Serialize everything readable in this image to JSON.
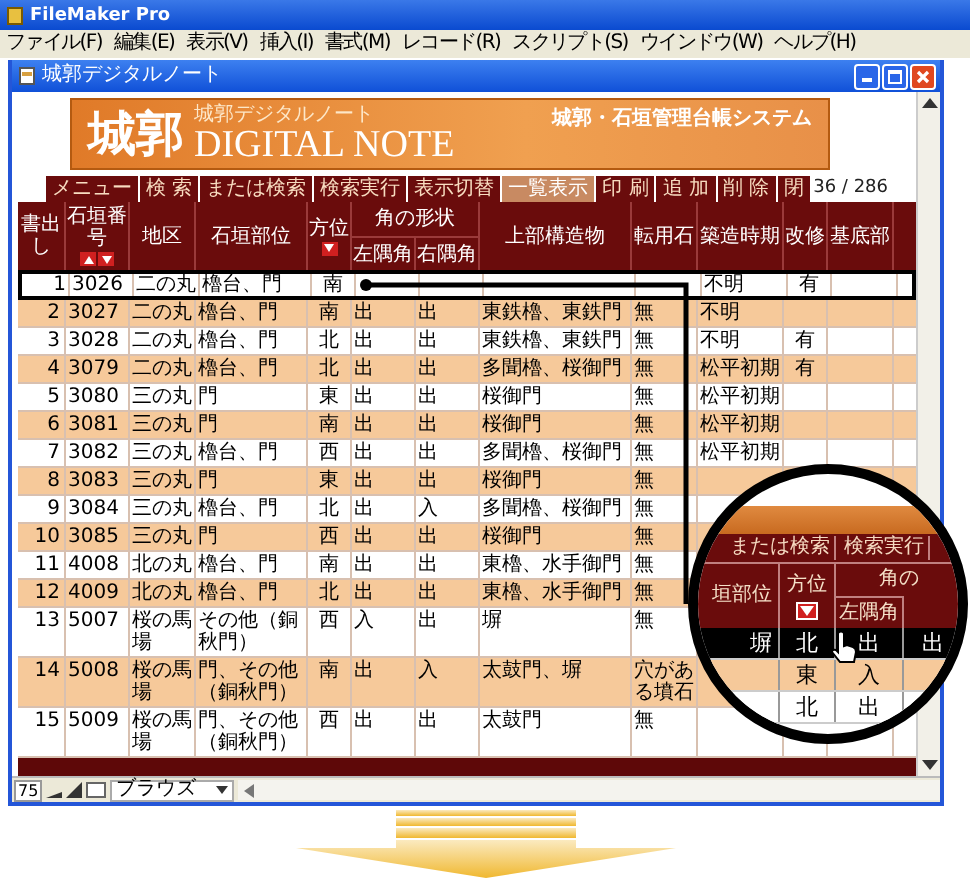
{
  "app_window": {
    "title": "FileMaker Pro"
  },
  "menu": [
    "ファイル(F)",
    "編集(E)",
    "表示(V)",
    "挿入(I)",
    "書式(M)",
    "レコード(R)",
    "スクリプト(S)",
    "ウインドウ(W)",
    "ヘルプ(H)"
  ],
  "document_window": {
    "title": "城郭デジタルノート"
  },
  "banner": {
    "logo": "城郭",
    "subtitle": "城郭デジタルノート",
    "title": "DIGITAL NOTE",
    "system_name": "城郭・石垣管理台帳システム"
  },
  "tabs": [
    {
      "label": "メニュー",
      "selected": false
    },
    {
      "label": "検 索",
      "selected": false
    },
    {
      "label": "または検索",
      "selected": false
    },
    {
      "label": "検索実行",
      "selected": false
    },
    {
      "label": "表示切替",
      "selected": false
    },
    {
      "label": "一覧表示",
      "selected": true
    },
    {
      "label": "印 刷",
      "selected": false
    },
    {
      "label": "追 加",
      "selected": false
    },
    {
      "label": "削 除",
      "selected": false
    },
    {
      "label": "閉",
      "selected": false
    }
  ],
  "record_count": "36 / 286",
  "table": {
    "column_group": "角の形状",
    "columns": [
      {
        "label": "書出し"
      },
      {
        "label": "石垣番号",
        "kind": "sort"
      },
      {
        "label": "地区"
      },
      {
        "label": "石垣部位"
      },
      {
        "label": "方位",
        "kind": "filter"
      },
      {
        "label": "左隅角",
        "grouped": true
      },
      {
        "label": "右隅角",
        "grouped": true
      },
      {
        "label": "上部構造物"
      },
      {
        "label": "転用石"
      },
      {
        "label": "築造時期"
      },
      {
        "label": "改修"
      },
      {
        "label": "基底部"
      }
    ],
    "rows": [
      {
        "selected": true,
        "no": "1",
        "stone_no": "3026",
        "area": "二の丸",
        "part": "櫓台、門",
        "direction": "南",
        "period": "不明",
        "repair": "有"
      },
      {
        "selected": false,
        "no": "2",
        "stone_no": "3027",
        "area": "二の丸",
        "part": "櫓台、門",
        "direction": "南",
        "left_corner": "出",
        "right_corner": "出",
        "upper_structure": "東鉄櫓、東鉄門",
        "reused_stone": "無",
        "period": "不明"
      },
      {
        "selected": false,
        "no": "3",
        "stone_no": "3028",
        "area": "二の丸",
        "part": "櫓台、門",
        "direction": "北",
        "left_corner": "出",
        "right_corner": "出",
        "upper_structure": "東鉄櫓、東鉄門",
        "reused_stone": "無",
        "period": "不明",
        "repair": "有"
      },
      {
        "selected": false,
        "no": "4",
        "stone_no": "3079",
        "area": "二の丸",
        "part": "櫓台、門",
        "direction": "北",
        "left_corner": "出",
        "right_corner": "出",
        "upper_structure": "多聞櫓、桜御門",
        "reused_stone": "無",
        "period": "松平初期",
        "repair": "有"
      },
      {
        "selected": false,
        "no": "5",
        "stone_no": "3080",
        "area": "三の丸",
        "part": "門",
        "direction": "東",
        "left_corner": "出",
        "right_corner": "出",
        "upper_structure": "桜御門",
        "reused_stone": "無",
        "period": "松平初期"
      },
      {
        "selected": false,
        "no": "6",
        "stone_no": "3081",
        "area": "三の丸",
        "part": "門",
        "direction": "南",
        "left_corner": "出",
        "right_corner": "出",
        "upper_structure": "桜御門",
        "reused_stone": "無",
        "period": "松平初期"
      },
      {
        "selected": false,
        "no": "7",
        "stone_no": "3082",
        "area": "三の丸",
        "part": "櫓台、門",
        "direction": "西",
        "left_corner": "出",
        "right_corner": "出",
        "upper_structure": "多聞櫓、桜御門",
        "reused_stone": "無",
        "period": "松平初期"
      },
      {
        "selected": false,
        "no": "8",
        "stone_no": "3083",
        "area": "三の丸",
        "part": "門",
        "direction": "東",
        "left_corner": "出",
        "right_corner": "出",
        "upper_structure": "桜御門",
        "reused_stone": "無"
      },
      {
        "selected": false,
        "no": "9",
        "stone_no": "3084",
        "area": "三の丸",
        "part": "櫓台、門",
        "direction": "北",
        "left_corner": "出",
        "right_corner": "入",
        "upper_structure": "多聞櫓、桜御門",
        "reused_stone": "無"
      },
      {
        "selected": false,
        "no": "10",
        "stone_no": "3085",
        "area": "三の丸",
        "part": "門",
        "direction": "西",
        "left_corner": "出",
        "right_corner": "出",
        "upper_structure": "桜御門",
        "reused_stone": "無"
      },
      {
        "selected": false,
        "no": "11",
        "stone_no": "4008",
        "area": "北の丸",
        "part": "櫓台、門",
        "direction": "南",
        "left_corner": "出",
        "right_corner": "出",
        "upper_structure": "東櫓、水手御門",
        "reused_stone": "無"
      },
      {
        "selected": false,
        "no": "12",
        "stone_no": "4009",
        "area": "北の丸",
        "part": "櫓台、門",
        "direction": "北",
        "left_corner": "出",
        "right_corner": "出",
        "upper_structure": "東櫓、水手御門",
        "reused_stone": "無"
      },
      {
        "selected": false,
        "no": "13",
        "stone_no": "5007",
        "area": "桜の馬場",
        "part": "その他（銅秋門）",
        "direction": "西",
        "left_corner": "入",
        "right_corner": "出",
        "upper_structure": "塀",
        "reused_stone": "無"
      },
      {
        "selected": false,
        "no": "14",
        "stone_no": "5008",
        "area": "桜の馬場",
        "part": "門、その他（銅秋門）",
        "direction": "南",
        "left_corner": "出",
        "right_corner": "入",
        "upper_structure": "太鼓門、塀",
        "reused_stone": "穴がある墳石"
      },
      {
        "selected": false,
        "no": "15",
        "stone_no": "5009",
        "area": "桜の馬場",
        "part": "門、その他（銅秋門）",
        "direction": "西",
        "left_corner": "出",
        "right_corner": "出",
        "upper_structure": "太鼓門",
        "reused_stone": "無"
      }
    ]
  },
  "status_bar": {
    "zoom": "75",
    "mode": "ブラウズ"
  },
  "magnifier": {
    "tabs": [
      "または検索",
      "検索実行"
    ],
    "group_header": "角の",
    "headers": [
      "垣部位",
      "方位",
      "左隅角"
    ],
    "rows": [
      {
        "selected": true,
        "part": "塀",
        "direction": "北",
        "left_corner": "出",
        "right_corner": "出"
      },
      {
        "selected": false,
        "direction": "東",
        "left_corner": "入"
      },
      {
        "selected": false,
        "direction": "北",
        "left_corner": "出"
      }
    ]
  }
}
